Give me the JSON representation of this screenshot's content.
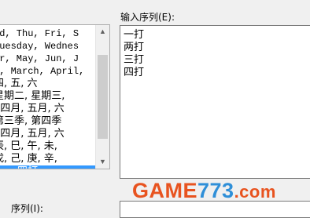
{
  "custom_lists": {
    "items": [
      {
        "text": "ed, Thu, Fri, S",
        "cn": false
      },
      {
        "text": "Tuesday, Wednes",
        "cn": false
      },
      {
        "text": "or, May, Jun, J",
        "cn": false
      },
      {
        "text": "y, March, April,",
        "cn": false
      },
      {
        "text": "四, 五, 六",
        "cn": true
      },
      {
        "text": "星期二, 星期三,",
        "cn": true
      },
      {
        "text": ", 四月, 五月, 六",
        "cn": true
      },
      {
        "text": "第三季, 第四季",
        "cn": true
      },
      {
        "text": ", 四月, 五月, 六",
        "cn": true
      },
      {
        "text": "辰, 巳, 午, 未,",
        "cn": true
      },
      {
        "text": "戊, 己, 庚, 辛,",
        "cn": true
      },
      {
        "text": "四打",
        "cn": true,
        "selected": true
      }
    ]
  },
  "sequence": {
    "label": "输入序列(E):",
    "entries": [
      "一打",
      "两打",
      "三打",
      "四打"
    ]
  },
  "bottom": {
    "label": "序列(I):"
  },
  "watermark": {
    "part1": "GAME",
    "part2": "773",
    "part3": ".com"
  }
}
